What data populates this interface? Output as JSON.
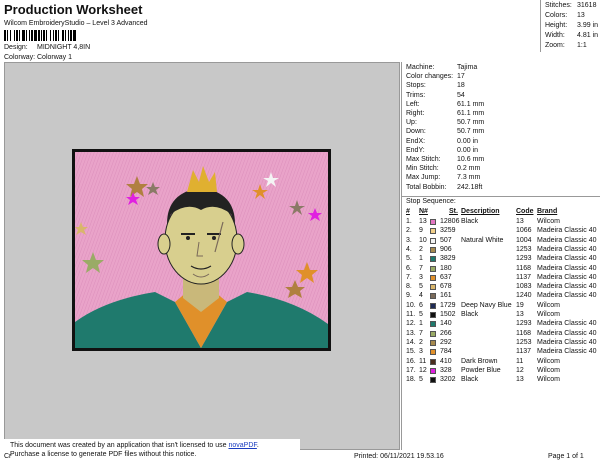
{
  "header": {
    "title": "Production Worksheet",
    "software": "Wilcom EmbroideryStudio – Level 3 Advanced",
    "design_label": "Design:",
    "design_value": "MIDNIGHT 4,8IN",
    "colorway_label": "Colorway:",
    "colorway_value": "Colorway 1"
  },
  "stats": [
    {
      "label": "Stitches:",
      "value": "31618"
    },
    {
      "label": "Colors:",
      "value": "13"
    },
    {
      "label": "Height:",
      "value": "3.99 in"
    },
    {
      "label": "Width:",
      "value": "4.81 in"
    },
    {
      "label": "Zoom:",
      "value": "1:1"
    }
  ],
  "machine_info": [
    {
      "label": "Machine:",
      "value": "Tajima"
    },
    {
      "label": "Color changes:",
      "value": "17"
    },
    {
      "label": "Stops:",
      "value": "18"
    },
    {
      "label": "Trims:",
      "value": "54"
    },
    {
      "label": "Left:",
      "value": "61.1 mm"
    },
    {
      "label": "Right:",
      "value": "61.1 mm"
    },
    {
      "label": "Up:",
      "value": "50.7 mm"
    },
    {
      "label": "Down:",
      "value": "50.7 mm"
    },
    {
      "label": "EndX:",
      "value": "0.00 in"
    },
    {
      "label": "EndY:",
      "value": "0.00 in"
    },
    {
      "label": "Max Stitch:",
      "value": "10.6 mm"
    },
    {
      "label": "Min Stitch:",
      "value": "0.2 mm"
    },
    {
      "label": "Max Jump:",
      "value": "7.3 mm"
    },
    {
      "label": "Total Bobbin:",
      "value": "242.18ft"
    }
  ],
  "sequence": {
    "title": "Stop Sequence:",
    "headers": {
      "num": "#",
      "n": "N#",
      "st": "St.",
      "description": "Description",
      "code": "Code",
      "brand": "Brand"
    },
    "rows": [
      {
        "num": "1.",
        "n": "13",
        "color": "#e377c2",
        "st": "12806",
        "description": "Black",
        "code": "13",
        "brand": "Wilcom"
      },
      {
        "num": "2.",
        "n": "9",
        "color": "#f2d08a",
        "st": "3259",
        "description": "",
        "code": "1066",
        "brand": "Madeira Classic 40"
      },
      {
        "num": "3.",
        "n": "10",
        "color": "#f4f4f4",
        "st": "507",
        "description": "Natural White",
        "code": "1004",
        "brand": "Madeira Classic 40"
      },
      {
        "num": "4.",
        "n": "2",
        "color": "#a68a4e",
        "st": "906",
        "description": "",
        "code": "1253",
        "brand": "Madeira Classic 40"
      },
      {
        "num": "5.",
        "n": "1",
        "color": "#1f7a6d",
        "st": "3829",
        "description": "",
        "code": "1293",
        "brand": "Madeira Classic 40"
      },
      {
        "num": "6.",
        "n": "7",
        "color": "#9aab66",
        "st": "180",
        "description": "",
        "code": "1168",
        "brand": "Madeira Classic 40"
      },
      {
        "num": "7.",
        "n": "3",
        "color": "#e0902a",
        "st": "637",
        "description": "",
        "code": "1137",
        "brand": "Madeira Classic 40"
      },
      {
        "num": "8.",
        "n": "5",
        "color": "#d9b66b",
        "st": "678",
        "description": "",
        "code": "1083",
        "brand": "Madeira Classic 40"
      },
      {
        "num": "9.",
        "n": "4",
        "color": "#7a6a5a",
        "st": "161",
        "description": "",
        "code": "1240",
        "brand": "Madeira Classic 40"
      },
      {
        "num": "10.",
        "n": "6",
        "color": "#1e2a55",
        "st": "1729",
        "description": "Deep Navy Blue",
        "code": "19",
        "brand": "Wilcom"
      },
      {
        "num": "11.",
        "n": "5",
        "color": "#111111",
        "st": "1502",
        "description": "Black",
        "code": "13",
        "brand": "Wilcom"
      },
      {
        "num": "12.",
        "n": "1",
        "color": "#1f7a6d",
        "st": "140",
        "description": "",
        "code": "1293",
        "brand": "Madeira Classic 40"
      },
      {
        "num": "13.",
        "n": "7",
        "color": "#9aab66",
        "st": "266",
        "description": "",
        "code": "1168",
        "brand": "Madeira Classic 40"
      },
      {
        "num": "14.",
        "n": "2",
        "color": "#a68a4e",
        "st": "292",
        "description": "",
        "code": "1253",
        "brand": "Madeira Classic 40"
      },
      {
        "num": "15.",
        "n": "3",
        "color": "#e0902a",
        "st": "784",
        "description": "",
        "code": "1137",
        "brand": "Madeira Classic 40"
      },
      {
        "num": "16.",
        "n": "11",
        "color": "#4a2e1e",
        "st": "410",
        "description": "Dark Brown",
        "code": "11",
        "brand": "Wilcom"
      },
      {
        "num": "17.",
        "n": "12",
        "color": "#e020e0",
        "st": "328",
        "description": "Powder Blue",
        "code": "12",
        "brand": "Wilcom"
      },
      {
        "num": "18.",
        "n": "5",
        "color": "#111111",
        "st": "3202",
        "description": "Black",
        "code": "13",
        "brand": "Wilcom"
      }
    ]
  },
  "notice": {
    "line1_prefix": "This document was created by an application that isn't licensed to use ",
    "link": "novaPDF",
    "line1_suffix": ".",
    "line2": "Purchase a license to generate PDF files without this notice."
  },
  "footer": {
    "left": "Cr",
    "printed": "Printed: 06/11/2021 19.53.16",
    "page": "Page 1 of 1"
  },
  "colors": {
    "artwork_bg": "#e9a3c9",
    "artwork_border": "#111111",
    "jacket": "#1f7a6d",
    "skin": "#d8cf8e",
    "hair_tip": "#e0b030"
  }
}
